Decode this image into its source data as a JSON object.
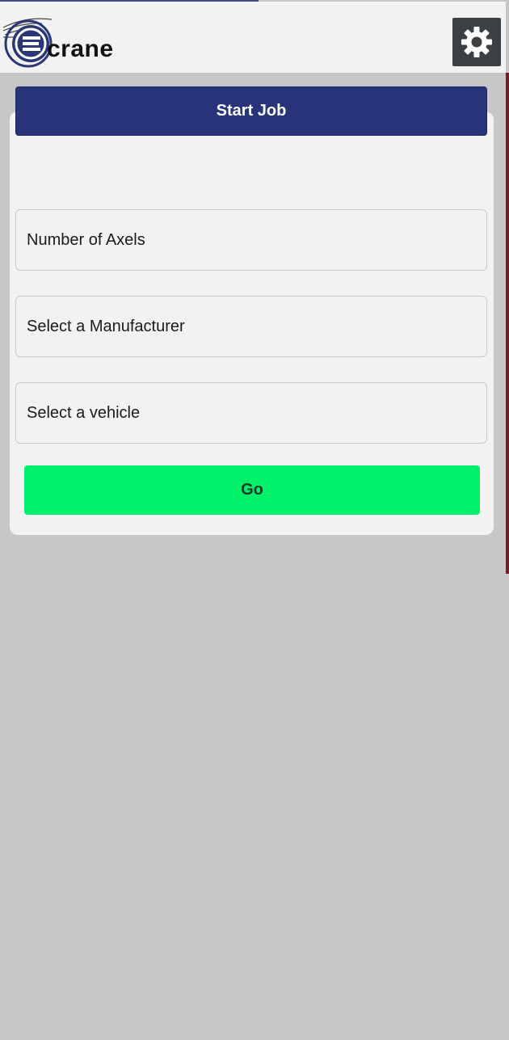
{
  "header": {
    "logo_text": "crane",
    "settings_icon": "gear-icon"
  },
  "card": {
    "start_job_label": "Start Job",
    "fields": {
      "axels": "Number of Axels",
      "manufacturer": "Select a Manufacturer",
      "vehicle": "Select a vehicle"
    },
    "go_label": "Go"
  },
  "colors": {
    "header_bg": "#f2f2f2",
    "page_bg": "#c6c7c9",
    "primary": "#28347a",
    "go": "#00f06a",
    "settings_bg": "#3d4042"
  }
}
